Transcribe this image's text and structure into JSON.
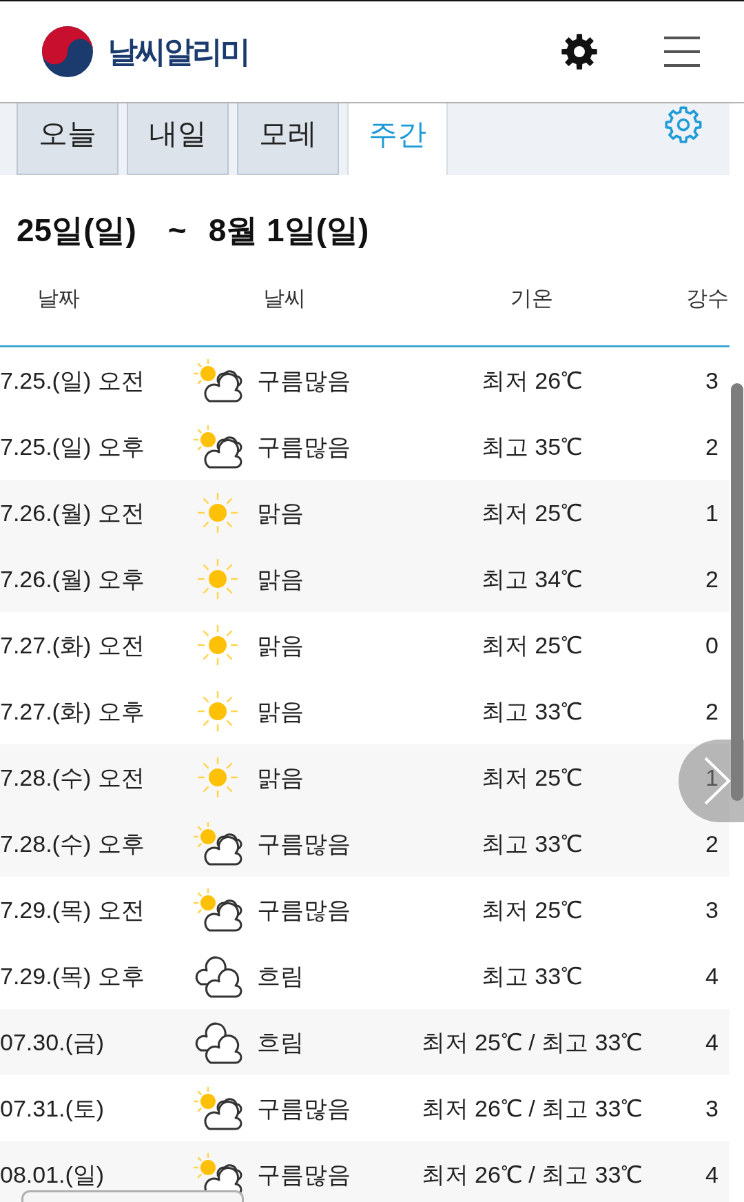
{
  "header": {
    "title": "날씨알리미"
  },
  "tabs": [
    {
      "label": "오늘",
      "selected": false
    },
    {
      "label": "내일",
      "selected": false
    },
    {
      "label": "모레",
      "selected": false
    },
    {
      "label": "주간",
      "selected": true
    }
  ],
  "period": {
    "start": "25일(일)",
    "separator": "~",
    "end": "8월 1일(일)"
  },
  "table": {
    "columns": [
      "날짜",
      "날씨",
      "기온",
      "강수"
    ],
    "days": [
      {
        "rows": [
          {
            "date": "7.25.(일) 오전",
            "kind": "partly_cloudy",
            "weather": "구름많음",
            "temperature": "최저 26℃",
            "precipitation": "3"
          },
          {
            "date": "7.25.(일) 오후",
            "kind": "partly_cloudy",
            "weather": "구름많음",
            "temperature": "최고 35℃",
            "precipitation": "2"
          }
        ]
      },
      {
        "rows": [
          {
            "date": "7.26.(월) 오전",
            "kind": "sunny",
            "weather": "맑음",
            "temperature": "최저 25℃",
            "precipitation": "1"
          },
          {
            "date": "7.26.(월) 오후",
            "kind": "sunny",
            "weather": "맑음",
            "temperature": "최고 34℃",
            "precipitation": "2"
          }
        ]
      },
      {
        "rows": [
          {
            "date": "7.27.(화) 오전",
            "kind": "sunny",
            "weather": "맑음",
            "temperature": "최저 25℃",
            "precipitation": "0"
          },
          {
            "date": "7.27.(화) 오후",
            "kind": "sunny",
            "weather": "맑음",
            "temperature": "최고 33℃",
            "precipitation": "2"
          }
        ]
      },
      {
        "rows": [
          {
            "date": "7.28.(수) 오전",
            "kind": "sunny",
            "weather": "맑음",
            "temperature": "최저 25℃",
            "precipitation": "1"
          },
          {
            "date": "7.28.(수) 오후",
            "kind": "partly_cloudy",
            "weather": "구름많음",
            "temperature": "최고 33℃",
            "precipitation": "2"
          }
        ]
      },
      {
        "rows": [
          {
            "date": "7.29.(목) 오전",
            "kind": "partly_cloudy",
            "weather": "구름많음",
            "temperature": "최저 25℃",
            "precipitation": "3"
          },
          {
            "date": "7.29.(목) 오후",
            "kind": "cloudy",
            "weather": "흐림",
            "temperature": "최고 33℃",
            "precipitation": "4"
          }
        ]
      },
      {
        "rows": [
          {
            "date": "07.30.(금)",
            "kind": "cloudy",
            "weather": "흐림",
            "temperature": "최저 25℃ / 최고 33℃",
            "precipitation": "4"
          }
        ]
      },
      {
        "rows": [
          {
            "date": "07.31.(토)",
            "kind": "partly_cloudy",
            "weather": "구름많음",
            "temperature": "최저 26℃ / 최고 33℃",
            "precipitation": "3"
          }
        ]
      },
      {
        "rows": [
          {
            "date": "08.01.(일)",
            "kind": "partly_cloudy",
            "weather": "구름많음",
            "temperature": "최저 26℃ / 최고 33℃",
            "precipitation": "4"
          }
        ]
      }
    ]
  }
}
